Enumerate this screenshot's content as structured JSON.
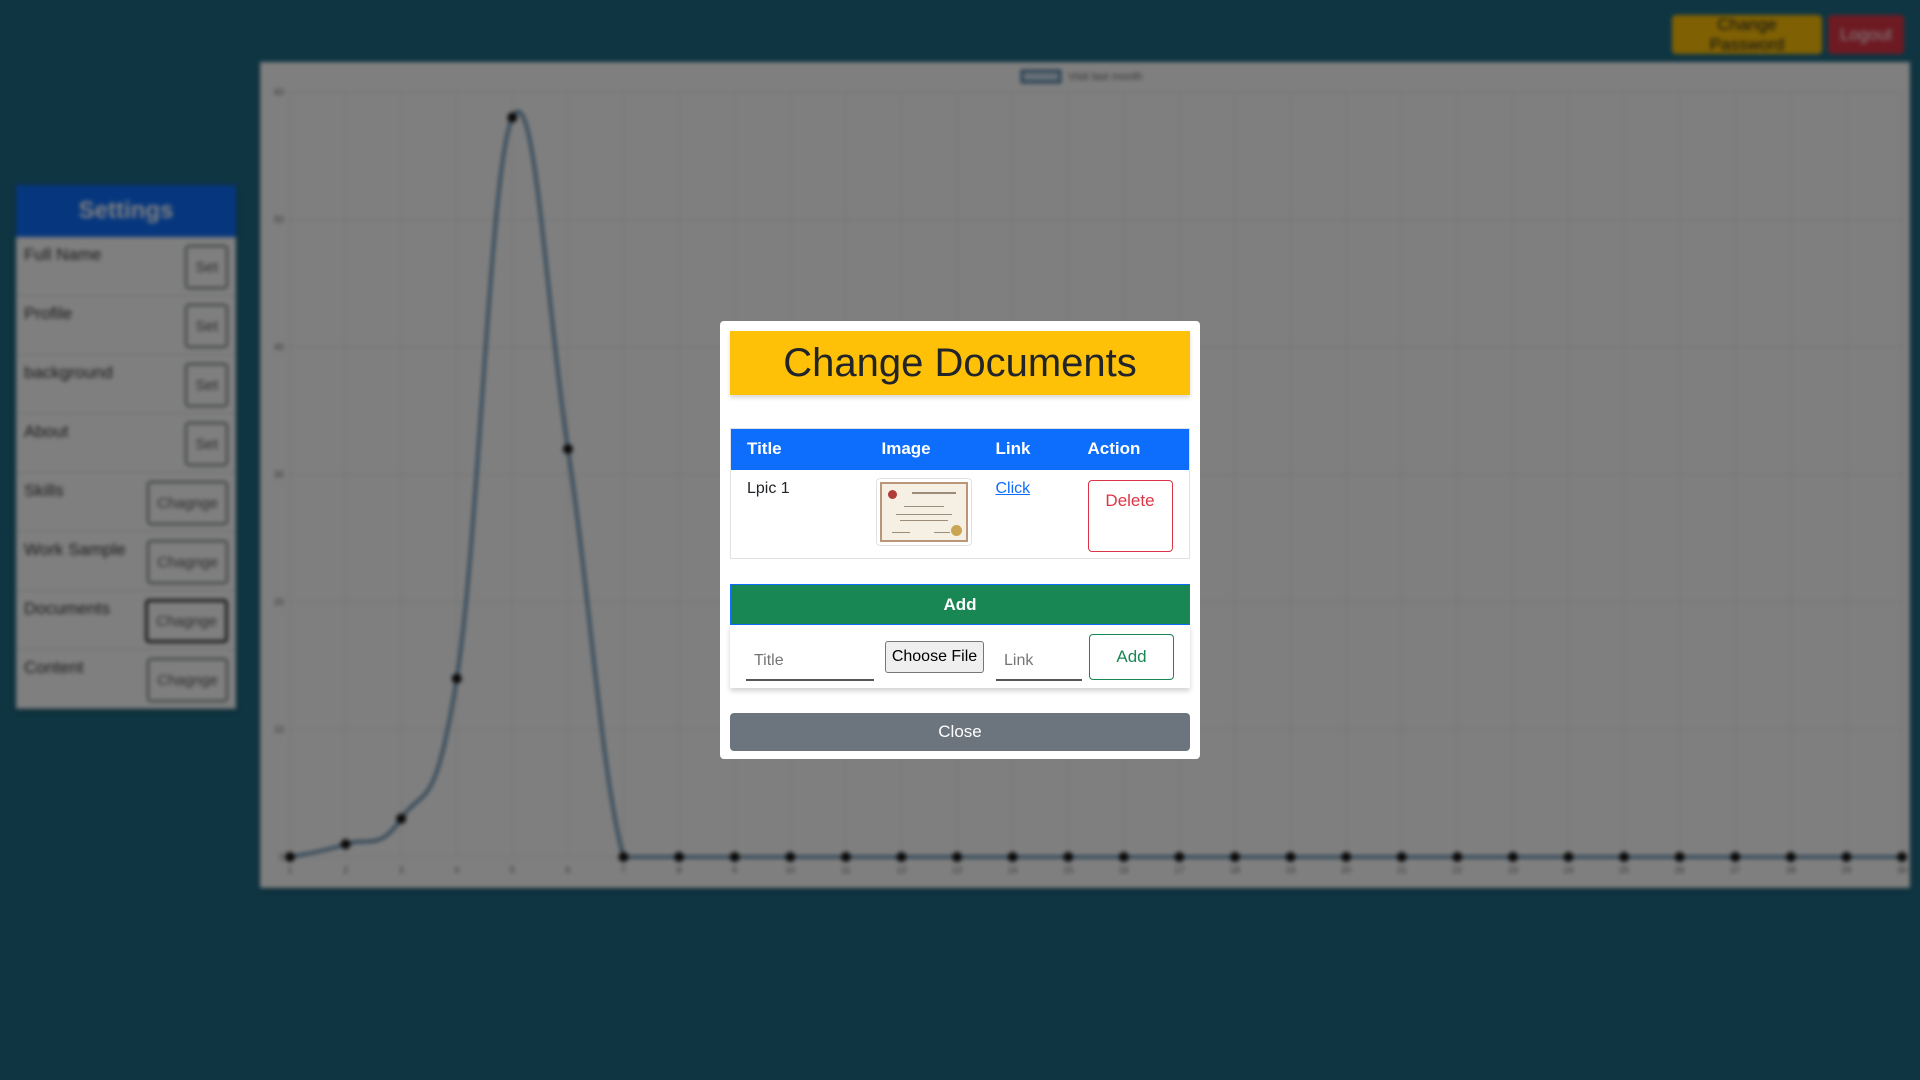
{
  "header": {
    "change_password": "Change Password",
    "logout": "Logout"
  },
  "settings": {
    "title": "Settings",
    "items": [
      {
        "label": "Full Name",
        "button": "Set"
      },
      {
        "label": "Profile",
        "button": "Set"
      },
      {
        "label": "background",
        "button": "Set"
      },
      {
        "label": "About",
        "button": "Set"
      },
      {
        "label": "Skills",
        "button": "Chagnge"
      },
      {
        "label": "Work Sample",
        "button": "Chagnge"
      },
      {
        "label": "Documents",
        "button": "Chagnge"
      },
      {
        "label": "Content",
        "button": "Chagnge"
      }
    ]
  },
  "chart_data": {
    "type": "line",
    "legend": "Visit last month",
    "legend_position": "top-center",
    "grid": true,
    "x": [
      1,
      2,
      3,
      4,
      5,
      6,
      7,
      8,
      9,
      10,
      11,
      12,
      13,
      14,
      15,
      16,
      17,
      18,
      19,
      20,
      21,
      22,
      23,
      24,
      25,
      26,
      27,
      28,
      29,
      30
    ],
    "series": [
      {
        "name": "Visit last month",
        "values": [
          0,
          1,
          3,
          14,
          58,
          32,
          0,
          0,
          0,
          0,
          0,
          0,
          0,
          0,
          0,
          0,
          0,
          0,
          0,
          0,
          0,
          0,
          0,
          0,
          0,
          0,
          0,
          0,
          0,
          0
        ]
      }
    ],
    "yticks": [
      0,
      10,
      20,
      30,
      40,
      50,
      60
    ],
    "ylim": [
      0,
      60
    ],
    "colors": {
      "line": "#4b7fa6",
      "point": "#111111",
      "grid": "#e5e5e5"
    }
  },
  "modal": {
    "title": "Change Documents",
    "table": {
      "headers": {
        "title": "Title",
        "image": "Image",
        "link": "Link",
        "action": "Action"
      },
      "rows": [
        {
          "title": "Lpic 1",
          "link_text": "Click",
          "action": "Delete",
          "image": "certificate-thumbnail"
        }
      ]
    },
    "add_header": "Add",
    "form": {
      "title_placeholder": "Title",
      "file_button": "Choose File",
      "link_placeholder": "Link",
      "add_button": "Add"
    },
    "close": "Close"
  },
  "colors": {
    "background": "#1e6b86",
    "primary": "#0d6efd",
    "warning": "#ffc107",
    "success": "#198754",
    "danger": "#dc3545",
    "secondary": "#6c757d"
  }
}
